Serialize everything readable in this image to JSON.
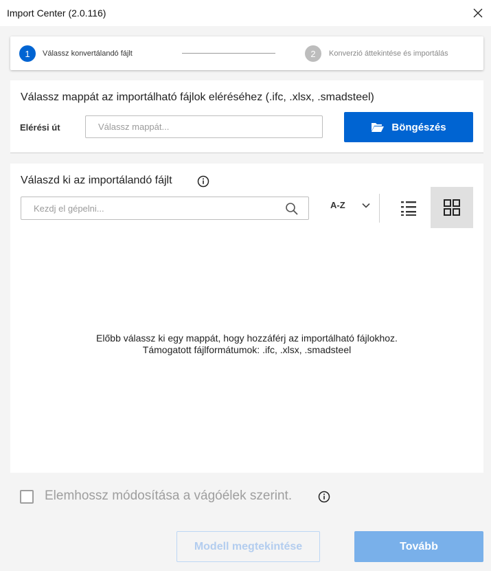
{
  "window": {
    "title": "Import Center (2.0.116)"
  },
  "stepper": {
    "steps": [
      {
        "number": "1",
        "label": "Válassz konvertálandó fájlt",
        "state": "active"
      },
      {
        "number": "2",
        "label": "Konverzió áttekintése és importálás",
        "state": "inactive"
      }
    ]
  },
  "folder_section": {
    "title": "Válassz mappát az importálható fájlok eléréséhez (.ifc, .xlsx, .smadsteel)",
    "path_label": "Elérési út",
    "path_value": "",
    "path_placeholder": "Válassz mappát...",
    "browse_label": "Böngészés"
  },
  "files_section": {
    "title": "Válaszd ki az importálandó fájlt",
    "search_value": "",
    "search_placeholder": "Kezdj el gépelni...",
    "sort_label": "A-Z",
    "view_mode": "grid",
    "empty_line1": "Előbb válassz ki egy mappát, hogy hozzáférj az importálható fájlokhoz.",
    "empty_line2": "Támogatott fájlformátumok: .ifc, .xlsx, .smadsteel"
  },
  "options": {
    "adjust_length_label": "Elemhossz módosítása a vágóélek szerint.",
    "adjust_length_checked": false
  },
  "footer": {
    "preview_label": "Modell megtekintése",
    "next_label": "Tovább"
  },
  "colors": {
    "accent": "#0064d2",
    "step_inactive": "#bdbdbd",
    "disabled_primary": "#79b0ea"
  },
  "icons": {
    "close": "close-icon",
    "folder": "folder-open-icon",
    "info": "info-icon",
    "search": "search-icon",
    "sort": "chevron-down-icon",
    "list": "list-view-icon",
    "grid": "grid-view-icon"
  }
}
